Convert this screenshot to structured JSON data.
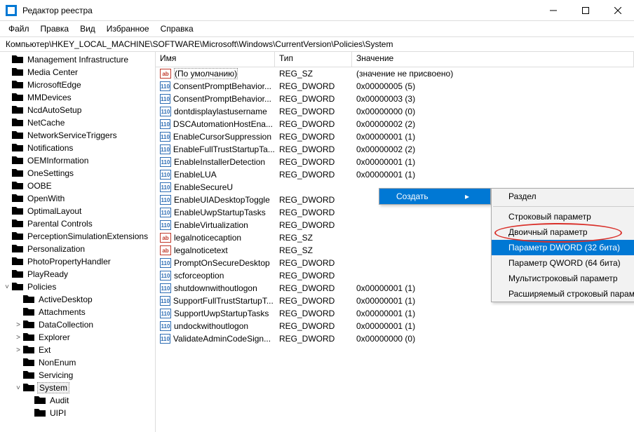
{
  "window": {
    "title": "Редактор реестра"
  },
  "menu": {
    "items": [
      "Файл",
      "Правка",
      "Вид",
      "Избранное",
      "Справка"
    ]
  },
  "address": {
    "path": "Компьютер\\HKEY_LOCAL_MACHINE\\SOFTWARE\\Microsoft\\Windows\\CurrentVersion\\Policies\\System"
  },
  "tree": {
    "items": [
      {
        "indent": 0,
        "toggle": "",
        "label": "Management Infrastructure"
      },
      {
        "indent": 0,
        "toggle": "",
        "label": "Media Center"
      },
      {
        "indent": 0,
        "toggle": "",
        "label": "MicrosoftEdge"
      },
      {
        "indent": 0,
        "toggle": "",
        "label": "MMDevices"
      },
      {
        "indent": 0,
        "toggle": "",
        "label": "NcdAutoSetup"
      },
      {
        "indent": 0,
        "toggle": "",
        "label": "NetCache"
      },
      {
        "indent": 0,
        "toggle": "",
        "label": "NetworkServiceTriggers"
      },
      {
        "indent": 0,
        "toggle": "",
        "label": "Notifications"
      },
      {
        "indent": 0,
        "toggle": "",
        "label": "OEMInformation"
      },
      {
        "indent": 0,
        "toggle": "",
        "label": "OneSettings"
      },
      {
        "indent": 0,
        "toggle": "",
        "label": "OOBE"
      },
      {
        "indent": 0,
        "toggle": "",
        "label": "OpenWith"
      },
      {
        "indent": 0,
        "toggle": "",
        "label": "OptimalLayout"
      },
      {
        "indent": 0,
        "toggle": "",
        "label": "Parental Controls"
      },
      {
        "indent": 0,
        "toggle": "",
        "label": "PerceptionSimulationExtensions"
      },
      {
        "indent": 0,
        "toggle": "",
        "label": "Personalization"
      },
      {
        "indent": 0,
        "toggle": "",
        "label": "PhotoPropertyHandler"
      },
      {
        "indent": 0,
        "toggle": "",
        "label": "PlayReady"
      },
      {
        "indent": 0,
        "toggle": "v",
        "label": "Policies"
      },
      {
        "indent": 1,
        "toggle": "",
        "label": "ActiveDesktop"
      },
      {
        "indent": 1,
        "toggle": "",
        "label": "Attachments"
      },
      {
        "indent": 1,
        "toggle": ">",
        "label": "DataCollection"
      },
      {
        "indent": 1,
        "toggle": ">",
        "label": "Explorer"
      },
      {
        "indent": 1,
        "toggle": ">",
        "label": "Ext"
      },
      {
        "indent": 1,
        "toggle": "",
        "label": "NonEnum"
      },
      {
        "indent": 1,
        "toggle": "",
        "label": "Servicing"
      },
      {
        "indent": 1,
        "toggle": "v",
        "label": "System",
        "selected": true
      },
      {
        "indent": 2,
        "toggle": "",
        "label": "Audit"
      },
      {
        "indent": 2,
        "toggle": "",
        "label": "UIPI"
      }
    ]
  },
  "columns": {
    "name": "Имя",
    "type": "Тип",
    "value": "Значение"
  },
  "values": [
    {
      "icon": "str",
      "name": "(По умолчанию)",
      "type": "REG_SZ",
      "value": "(значение не присвоено)",
      "selected": true
    },
    {
      "icon": "bin",
      "name": "ConsentPromptBehavior...",
      "type": "REG_DWORD",
      "value": "0x00000005 (5)"
    },
    {
      "icon": "bin",
      "name": "ConsentPromptBehavior...",
      "type": "REG_DWORD",
      "value": "0x00000003 (3)"
    },
    {
      "icon": "bin",
      "name": "dontdisplaylastusername",
      "type": "REG_DWORD",
      "value": "0x00000000 (0)"
    },
    {
      "icon": "bin",
      "name": "DSCAutomationHostEna...",
      "type": "REG_DWORD",
      "value": "0x00000002 (2)"
    },
    {
      "icon": "bin",
      "name": "EnableCursorSuppression",
      "type": "REG_DWORD",
      "value": "0x00000001 (1)"
    },
    {
      "icon": "bin",
      "name": "EnableFullTrustStartupTa...",
      "type": "REG_DWORD",
      "value": "0x00000002 (2)"
    },
    {
      "icon": "bin",
      "name": "EnableInstallerDetection",
      "type": "REG_DWORD",
      "value": "0x00000001 (1)"
    },
    {
      "icon": "bin",
      "name": "EnableLUA",
      "type": "REG_DWORD",
      "value": "0x00000001 (1)"
    },
    {
      "icon": "bin",
      "name": "EnableSecureU",
      "type": "",
      "value": ""
    },
    {
      "icon": "bin",
      "name": "EnableUIADesktopToggle",
      "type": "REG_DWORD",
      "value": ""
    },
    {
      "icon": "bin",
      "name": "EnableUwpStartupTasks",
      "type": "REG_DWORD",
      "value": ""
    },
    {
      "icon": "bin",
      "name": "EnableVirtualization",
      "type": "REG_DWORD",
      "value": ""
    },
    {
      "icon": "str",
      "name": "legalnoticecaption",
      "type": "REG_SZ",
      "value": ""
    },
    {
      "icon": "str",
      "name": "legalnoticetext",
      "type": "REG_SZ",
      "value": ""
    },
    {
      "icon": "bin",
      "name": "PromptOnSecureDesktop",
      "type": "REG_DWORD",
      "value": ""
    },
    {
      "icon": "bin",
      "name": "scforceoption",
      "type": "REG_DWORD",
      "value": ""
    },
    {
      "icon": "bin",
      "name": "shutdownwithoutlogon",
      "type": "REG_DWORD",
      "value": "0x00000001 (1)"
    },
    {
      "icon": "bin",
      "name": "SupportFullTrustStartupT...",
      "type": "REG_DWORD",
      "value": "0x00000001 (1)"
    },
    {
      "icon": "bin",
      "name": "SupportUwpStartupTasks",
      "type": "REG_DWORD",
      "value": "0x00000001 (1)"
    },
    {
      "icon": "bin",
      "name": "undockwithoutlogon",
      "type": "REG_DWORD",
      "value": "0x00000001 (1)"
    },
    {
      "icon": "bin",
      "name": "ValidateAdminCodeSign...",
      "type": "REG_DWORD",
      "value": "0x00000000 (0)"
    }
  ],
  "context1": {
    "create": "Создать"
  },
  "context2": {
    "items": [
      {
        "label": "Раздел",
        "sep_after": true
      },
      {
        "label": "Строковый параметр"
      },
      {
        "label": "Двоичный параметр"
      },
      {
        "label": "Параметр DWORD (32 бита)",
        "hl": true
      },
      {
        "label": "Параметр QWORD (64 бита)"
      },
      {
        "label": "Мультистроковый параметр"
      },
      {
        "label": "Расширяемый строковый параметр"
      }
    ]
  }
}
